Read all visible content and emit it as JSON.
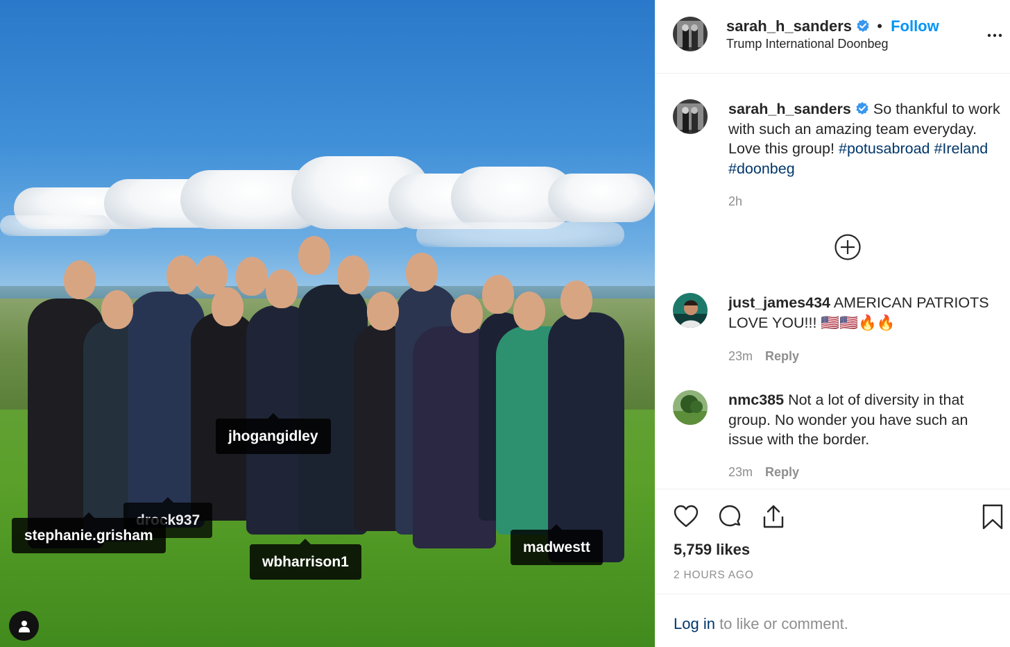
{
  "post": {
    "author": "sarah_h_sanders",
    "follow_label": "Follow",
    "separator": "•",
    "location": "Trump International Doonbeg",
    "more_label": "More options"
  },
  "photo": {
    "tags": [
      {
        "username": "jhogangidley"
      },
      {
        "username": "drock937"
      },
      {
        "username": "stephanie.grisham"
      },
      {
        "username": "wbharrison1"
      },
      {
        "username": "madwestt"
      }
    ]
  },
  "caption": {
    "username": "sarah_h_sanders",
    "text": "So thankful to work with such an amazing team everyday. Love this group!",
    "hashtags": [
      "#potusabroad",
      "#Ireland",
      "#doonbeg"
    ],
    "time": "2h"
  },
  "comments": [
    {
      "username": "just_james434",
      "text": "AMERICAN PATRIOTS LOVE YOU!!! 🇺🇸🇺🇸🔥🔥",
      "time": "23m",
      "reply_label": "Reply"
    },
    {
      "username": "nmc385",
      "text": "Not a lot of diversity in that group. No wonder you have such an issue with the border.",
      "time": "23m",
      "reply_label": "Reply"
    }
  ],
  "actions": {
    "like_icon": "heart-icon",
    "comment_icon": "comment-icon",
    "share_icon": "share-icon",
    "save_icon": "bookmark-icon"
  },
  "stats": {
    "likes": "5,759 likes",
    "time_ago": "2 HOURS AGO"
  },
  "footer": {
    "login_link": "Log in",
    "login_rest": " to like or comment."
  },
  "colors": {
    "accent": "#0095f6",
    "hashtag": "#00376b",
    "muted": "#8e8e8e",
    "text": "#262626"
  }
}
